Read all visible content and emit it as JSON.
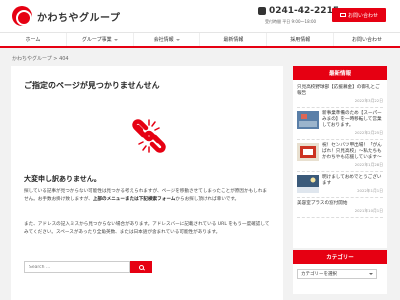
{
  "header": {
    "logo_text": "かわちやグループ",
    "phone": "0241-42-2215",
    "hours": "受付時間 平日 9:00〜18:00",
    "contact_label": "お問い合わせ"
  },
  "nav": {
    "items": [
      {
        "label": "ホーム",
        "has_caret": false
      },
      {
        "label": "グループ事業",
        "has_caret": true
      },
      {
        "label": "会社情報",
        "has_caret": true
      },
      {
        "label": "最新情報",
        "has_caret": false
      },
      {
        "label": "採用情報",
        "has_caret": false
      },
      {
        "label": "お問い合わせ",
        "has_caret": false
      }
    ]
  },
  "breadcrumb": "かわちやグループ > 404",
  "main": {
    "title": "ご指定のページが見つかりませんせん",
    "sorry_heading": "大変申し訳ありません。",
    "para1_a": "探している記事が見つからない可能性は見つかる考えられますが、ページを移動させてしまったことが原因かもしれません。お手数お掛け致しますが、",
    "para1_bold": "上部のメニューまたは下記検索フォーム",
    "para1_b": "からお探し頂ければ幸いです。",
    "para2": "また、アドレスの記入ミスから見つからない場合があります。アドレスバーに記載されている URL をもう一度確認してみてください。スペースがあったり全角英数、または日本語が含まれている可能性があります。",
    "search_placeholder": "Search ..."
  },
  "sidebar": {
    "news_heading": "最新情報",
    "news": [
      {
        "title": "只見高校野球部【応援募金】の御礼とご報告",
        "date": "2022年3月22日",
        "thumb": false
      },
      {
        "title": "新事業準備のため【スーパーみまの】を一時移転して営業しております。",
        "date": "2022年2月25日",
        "thumb": true
      },
      {
        "title": "祝！センバツ甲出場！「がんばれ！只見高校」〜私たちもかわちやも応援しています〜",
        "date": "2022年1月28日",
        "thumb": true
      },
      {
        "title": "明けましておめでとうございます",
        "date": "2022年1月1日",
        "thumb": true
      },
      {
        "title": "美容室プラスの窓付開始",
        "date": "2021年10月1日",
        "thumb": false
      }
    ],
    "category_heading": "カテゴリー",
    "category_select": "カテゴリーを選択"
  },
  "colors": {
    "accent": "#e60012",
    "background": "#f2f2f2"
  }
}
